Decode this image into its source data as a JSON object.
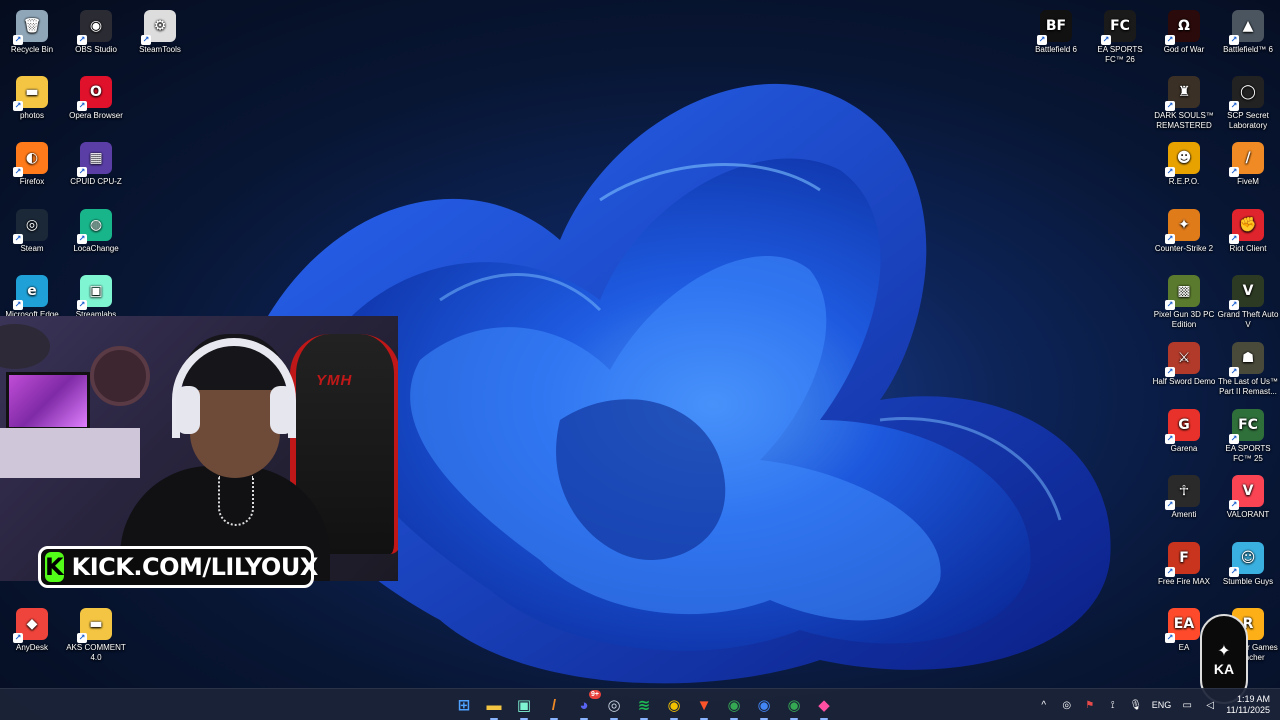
{
  "desktop_left": [
    {
      "label": "Recycle Bin",
      "icon": "recycle-bin-icon",
      "glyph": "🗑",
      "bg": "#8fa6b8"
    },
    {
      "label": "OBS Studio",
      "icon": "obs-icon",
      "glyph": "◉",
      "bg": "#2b2b33"
    },
    {
      "label": "SteamTools",
      "icon": "steamtools-icon",
      "glyph": "⚙",
      "bg": "#dddddd"
    },
    {
      "label": "photos",
      "icon": "folder-icon",
      "glyph": "▬",
      "bg": "#f4c542"
    },
    {
      "label": "Opera Browser",
      "icon": "opera-icon",
      "glyph": "O",
      "bg": "#e0112b"
    },
    {
      "label": "Firefox",
      "icon": "firefox-icon",
      "glyph": "◐",
      "bg": "#ff7a1a"
    },
    {
      "label": "CPUID CPU-Z",
      "icon": "cpuz-icon",
      "glyph": "▦",
      "bg": "#5a3ea6"
    },
    {
      "label": "Steam",
      "icon": "steam-icon",
      "glyph": "◎",
      "bg": "#1b2838"
    },
    {
      "label": "LocaChange",
      "icon": "locachange-icon",
      "glyph": "◍",
      "bg": "#19b58a"
    },
    {
      "label": "Microsoft Edge",
      "icon": "edge-icon",
      "glyph": "e",
      "bg": "#1fa0d6"
    },
    {
      "label": "Streamlabs",
      "icon": "streamlabs-icon",
      "glyph": "▣",
      "bg": "#80f5d2"
    },
    {
      "label": "AnyDesk",
      "icon": "anydesk-icon",
      "glyph": "◆",
      "bg": "#ef443b"
    },
    {
      "label": "AKS COMMENT 4.0",
      "icon": "folder-icon",
      "glyph": "▬",
      "bg": "#f4c542"
    }
  ],
  "desktop_right": [
    {
      "label": "Battlefield 6",
      "icon": "battlefield6-icon",
      "glyph": "BF",
      "bg": "#111111"
    },
    {
      "label": "EA SPORTS FC™ 26",
      "icon": "fc26-icon",
      "glyph": "FC",
      "bg": "#1a1a1a"
    },
    {
      "label": "God of War",
      "icon": "god-of-war-icon",
      "glyph": "Ω",
      "bg": "#2a0a0a"
    },
    {
      "label": "Battlefield™ 6",
      "icon": "battlefield-alt-icon",
      "glyph": "▲",
      "bg": "#4a5560"
    },
    {
      "label": "DARK SOULS™ REMASTERED",
      "icon": "dark-souls-icon",
      "glyph": "♜",
      "bg": "#3a3025"
    },
    {
      "label": "SCP Secret Laboratory",
      "icon": "scp-icon",
      "glyph": "◯",
      "bg": "#222222"
    },
    {
      "label": "R.E.P.O.",
      "icon": "repo-icon",
      "glyph": "☻",
      "bg": "#e8a200"
    },
    {
      "label": "FiveM",
      "icon": "fivem-icon",
      "glyph": "/",
      "bg": "#f08a24"
    },
    {
      "label": "Counter-Strike 2",
      "icon": "cs2-icon",
      "glyph": "✦",
      "bg": "#e07b1a"
    },
    {
      "label": "Riot Client",
      "icon": "riot-client-icon",
      "glyph": "✊",
      "bg": "#e0242d"
    },
    {
      "label": "Pixel Gun 3D PC Edition",
      "icon": "pixel-gun-icon",
      "glyph": "▩",
      "bg": "#5a7a2e"
    },
    {
      "label": "Grand Theft Auto V",
      "icon": "gta-icon",
      "glyph": "V",
      "bg": "#2d3a23"
    },
    {
      "label": "Half Sword Demo",
      "icon": "half-sword-icon",
      "glyph": "⚔",
      "bg": "#b23a2a"
    },
    {
      "label": "The Last of Us™ Part II Remast...",
      "icon": "tlou-icon",
      "glyph": "☗",
      "bg": "#4a4a3a"
    },
    {
      "label": "Garena",
      "icon": "garena-icon",
      "glyph": "G",
      "bg": "#e8312a"
    },
    {
      "label": "EA SPORTS FC™ 25",
      "icon": "fc25-icon",
      "glyph": "FC",
      "bg": "#2f6f3a"
    },
    {
      "label": "Amenti",
      "icon": "amenti-icon",
      "glyph": "☥",
      "bg": "#2a2a2a"
    },
    {
      "label": "VALORANT",
      "icon": "valorant-icon",
      "glyph": "V",
      "bg": "#fa4454"
    },
    {
      "label": "Free Fire MAX",
      "icon": "free-fire-icon",
      "glyph": "F",
      "bg": "#c8341e"
    },
    {
      "label": "Stumble Guys",
      "icon": "stumble-guys-icon",
      "glyph": "☺",
      "bg": "#3ab0e0"
    },
    {
      "label": "EA",
      "icon": "ea-icon",
      "glyph": "EA",
      "bg": "#ff4b2b"
    },
    {
      "label": "Rockstar Games Launcher",
      "icon": "rockstar-icon",
      "glyph": "R",
      "bg": "#fcaf17"
    }
  ],
  "stream": {
    "banner_text": "KICK.COM/LILYOUX",
    "kick_glyph": "K",
    "chair_logo": "YMH",
    "watermark_text": "KA"
  },
  "taskbar": {
    "apps": [
      {
        "name": "start-button-icon",
        "glyph": "⊞",
        "color": "#4fa3ff"
      },
      {
        "name": "file-explorer-icon",
        "glyph": "▬",
        "color": "#f4c542"
      },
      {
        "name": "streamlabs-taskbar-icon",
        "glyph": "▣",
        "color": "#80f5d2"
      },
      {
        "name": "fivem-taskbar-icon",
        "glyph": "/",
        "color": "#f08a24"
      },
      {
        "name": "discord-icon",
        "glyph": "◕",
        "color": "#5865f2"
      },
      {
        "name": "steam-taskbar-icon",
        "glyph": "◎",
        "color": "#c7d5e0"
      },
      {
        "name": "spotify-icon",
        "glyph": "≋",
        "color": "#1db954"
      },
      {
        "name": "chrome-icon",
        "glyph": "◉",
        "color": "#f2c200"
      },
      {
        "name": "brave-icon",
        "glyph": "▼",
        "color": "#fb542b"
      },
      {
        "name": "chrome-profile-icon",
        "glyph": "◉",
        "color": "#34a853"
      },
      {
        "name": "chrome-alt-icon",
        "glyph": "◉",
        "color": "#4285f4"
      },
      {
        "name": "chrome-dev-icon",
        "glyph": "◉",
        "color": "#34a853"
      },
      {
        "name": "kick-app-icon",
        "glyph": "◆",
        "color": "#ff4fa3"
      }
    ],
    "discord_badge": "9+",
    "tray_icons": [
      "chevron-up-icon",
      "steam-tray-icon",
      "shield-tray-icon",
      "usb-icon",
      "mic-icon"
    ],
    "tray_glyphs": [
      "^",
      "◎",
      "⚑",
      "⟟",
      "🎙"
    ],
    "language": "ENG",
    "time": "1:19 AM",
    "date": "11/11/2025"
  }
}
